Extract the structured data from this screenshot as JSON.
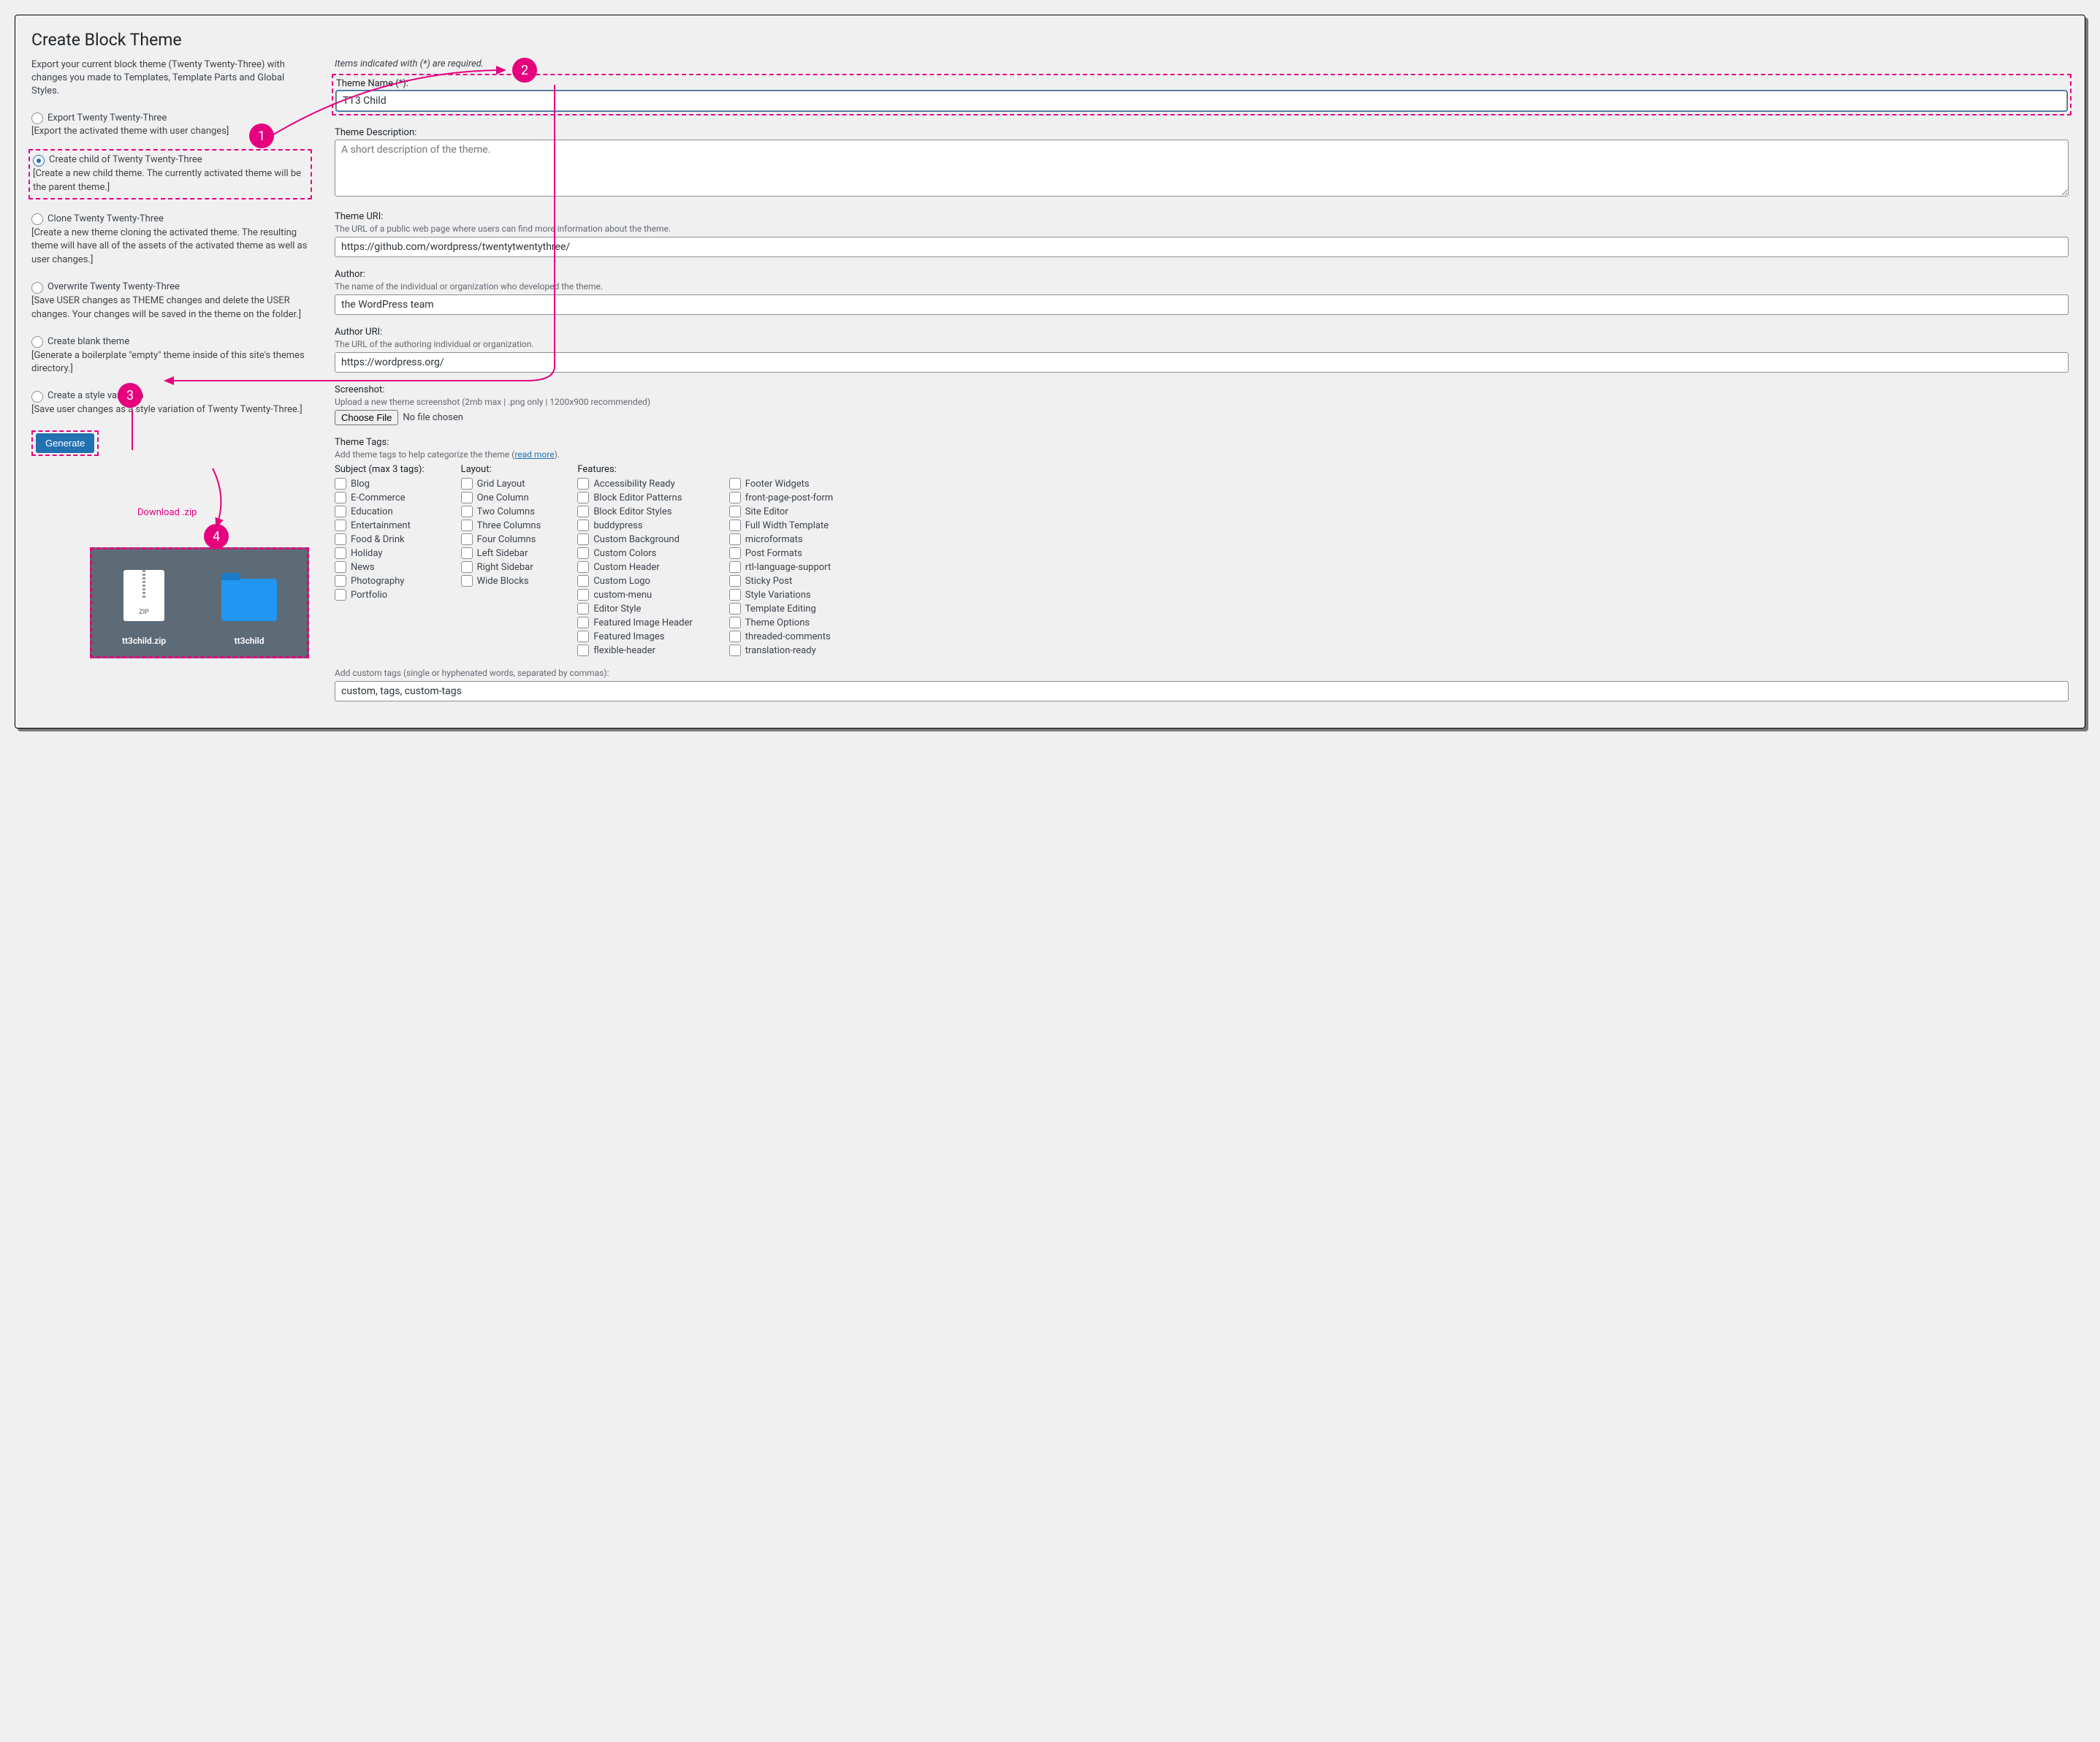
{
  "page": {
    "title": "Create Block Theme",
    "intro": "Export your current block theme (Twenty Twenty-Three) with changes you made to Templates, Template Parts and Global Styles."
  },
  "options": [
    {
      "label": "Export Twenty Twenty-Three",
      "desc": "[Export the activated theme with user changes]",
      "checked": false
    },
    {
      "label": "Create child of Twenty Twenty-Three",
      "desc": "[Create a new child theme. The currently activated theme will be the parent theme.]",
      "checked": true
    },
    {
      "label": "Clone Twenty Twenty-Three",
      "desc": "[Create a new theme cloning the activated theme. The resulting theme will have all of the assets of the activated theme as well as user changes.]",
      "checked": false
    },
    {
      "label": "Overwrite Twenty Twenty-Three",
      "desc": "[Save USER changes as THEME changes and delete the USER changes. Your changes will be saved in the theme on the folder.]",
      "checked": false
    },
    {
      "label": "Create blank theme",
      "desc": "[Generate a boilerplate \"empty\" theme inside of this site's themes directory.]",
      "checked": false
    },
    {
      "label": "Create a style variation",
      "desc": "[Save user changes as a style variation of Twenty Twenty-Three.]",
      "checked": false
    }
  ],
  "generate": "Generate",
  "download_label": "Download .zip",
  "files": {
    "zip": "tt3child.zip",
    "folder": "tt3child",
    "zip_badge": "ZIP"
  },
  "right": {
    "required_note": "Items indicated with (*) are required.",
    "theme_name_label": "Theme Name (*):",
    "theme_name_value": "TT3 Child",
    "theme_desc_label": "Theme Description:",
    "theme_desc_placeholder": "A short description of the theme.",
    "theme_uri_label": "Theme URI:",
    "theme_uri_hint": "The URL of a public web page where users can find more information about the theme.",
    "theme_uri_value": "https://github.com/wordpress/twentytwentythree/",
    "author_label": "Author:",
    "author_hint": "The name of the individual or organization who developed the theme.",
    "author_value": "the WordPress team",
    "author_uri_label": "Author URI:",
    "author_uri_hint": "The URL of the authoring individual or organization.",
    "author_uri_value": "https://wordpress.org/",
    "screenshot_label": "Screenshot:",
    "screenshot_hint": "Upload a new theme screenshot (2mb max | .png only | 1200x900 recommended)",
    "choose_file": "Choose File",
    "no_file": "No file chosen",
    "tags_label": "Theme Tags:",
    "tags_hint_pre": "Add theme tags to help categorize the theme (",
    "tags_hint_link": "read more",
    "tags_hint_post": ").",
    "custom_tags_label": "Add custom tags (single or hyphenated words, separated by commas):",
    "custom_tags_value": "custom, tags, custom-tags"
  },
  "tag_groups": {
    "subject": {
      "header": "Subject (max 3 tags):",
      "items": [
        "Blog",
        "E-Commerce",
        "Education",
        "Entertainment",
        "Food & Drink",
        "Holiday",
        "News",
        "Photography",
        "Portfolio"
      ]
    },
    "layout": {
      "header": "Layout:",
      "items": [
        "Grid Layout",
        "One Column",
        "Two Columns",
        "Three Columns",
        "Four Columns",
        "Left Sidebar",
        "Right Sidebar",
        "Wide Blocks"
      ]
    },
    "features": {
      "header": "Features:",
      "items": [
        "Accessibility Ready",
        "Block Editor Patterns",
        "Block Editor Styles",
        "buddypress",
        "Custom Background",
        "Custom Colors",
        "Custom Header",
        "Custom Logo",
        "custom-menu",
        "Editor Style",
        "Featured Image Header",
        "Featured Images",
        "flexible-header"
      ]
    },
    "features2": {
      "header": "",
      "items": [
        "Footer Widgets",
        "front-page-post-form",
        "Site Editor",
        "Full Width Template",
        "microformats",
        "Post Formats",
        "rtl-language-support",
        "Sticky Post",
        "Style Variations",
        "Template Editing",
        "Theme Options",
        "threaded-comments",
        "translation-ready"
      ]
    }
  },
  "callouts": {
    "c1": "1",
    "c2": "2",
    "c3": "3",
    "c4": "4"
  }
}
